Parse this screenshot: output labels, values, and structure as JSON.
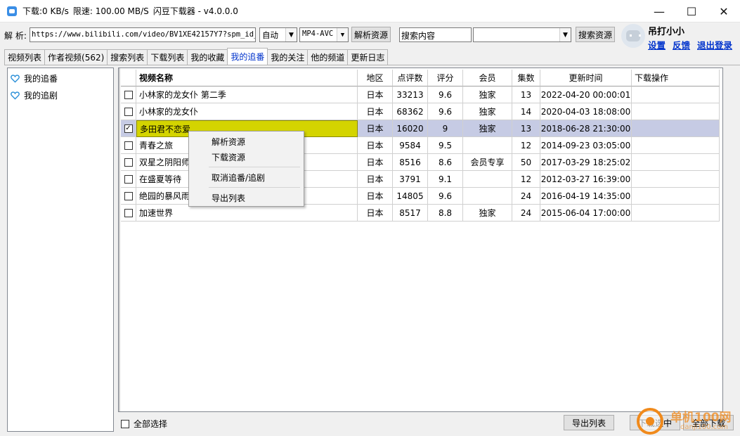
{
  "titlebar": {
    "download_speed": "下载:0 KB/s",
    "limit_speed": "限速: 100.00 MB/S",
    "app_name": "闪豆下载器 - v4.0.0.0",
    "minimize": "—",
    "maximize": "☐",
    "close": "✕"
  },
  "toolbar": {
    "parse_label": "解 析:",
    "url_value": "https://www.bilibili.com/video/BV1XE42157Y7?spm_id_fr",
    "quality_value": "自动",
    "format_value": "MP4-AVC",
    "parse_button": "解析资源",
    "search_placeholder": "搜索内容",
    "search_type_value": "",
    "search_button": "搜索资源"
  },
  "user": {
    "name": "吊打小小",
    "settings": "设置",
    "feedback": "反馈",
    "logout": "退出登录"
  },
  "tabs": [
    {
      "label": "视频列表"
    },
    {
      "label": "作者视频(562)"
    },
    {
      "label": "搜索列表"
    },
    {
      "label": "下载列表"
    },
    {
      "label": "我的收藏"
    },
    {
      "label": "我的追番",
      "active": true
    },
    {
      "label": "我的关注"
    },
    {
      "label": "他的频道"
    },
    {
      "label": "更新日志"
    }
  ],
  "left_panel": {
    "items": [
      {
        "label": "我的追番"
      },
      {
        "label": "我的追剧"
      }
    ]
  },
  "table": {
    "headers": {
      "name": "视频名称",
      "region": "地区",
      "comments": "点评数",
      "rating": "评分",
      "member": "会员",
      "episodes": "集数",
      "updated": "更新时间",
      "action": "下载操作"
    },
    "rows": [
      {
        "checked": false,
        "name": "小林家的龙女仆 第二季",
        "region": "日本",
        "comments": "33213",
        "rating": "9.6",
        "member": "独家",
        "episodes": "13",
        "updated": "2022-04-20 00:00:01",
        "action": ""
      },
      {
        "checked": false,
        "name": "小林家的龙女仆",
        "region": "日本",
        "comments": "68362",
        "rating": "9.6",
        "member": "独家",
        "episodes": "14",
        "updated": "2020-04-03 18:08:00",
        "action": ""
      },
      {
        "checked": true,
        "name": "多田君不恋爱",
        "region": "日本",
        "comments": "16020",
        "rating": "9",
        "member": "独家",
        "episodes": "13",
        "updated": "2018-06-28 21:30:00",
        "action": ""
      },
      {
        "checked": false,
        "name": "青春之旅",
        "region": "日本",
        "comments": "9584",
        "rating": "9.5",
        "member": "",
        "episodes": "12",
        "updated": "2014-09-23 03:05:00",
        "action": ""
      },
      {
        "checked": false,
        "name": "双星之阴阳师",
        "region": "日本",
        "comments": "8516",
        "rating": "8.6",
        "member": "会员专享",
        "episodes": "50",
        "updated": "2017-03-29 18:25:02",
        "action": ""
      },
      {
        "checked": false,
        "name": "在盛夏等待",
        "region": "日本",
        "comments": "3791",
        "rating": "9.1",
        "member": "",
        "episodes": "12",
        "updated": "2012-03-27 16:39:00",
        "action": ""
      },
      {
        "checked": false,
        "name": "绝园的暴风雨",
        "region": "日本",
        "comments": "14805",
        "rating": "9.6",
        "member": "",
        "episodes": "24",
        "updated": "2016-04-19 14:35:00",
        "action": ""
      },
      {
        "checked": false,
        "name": "加速世界",
        "region": "日本",
        "comments": "8517",
        "rating": "8.8",
        "member": "独家",
        "episodes": "24",
        "updated": "2015-06-04 17:00:00",
        "action": ""
      }
    ],
    "selected_row": 2
  },
  "context_menu": {
    "items": [
      "解析资源",
      "下载资源",
      "取消追番/追剧",
      "导出列表"
    ]
  },
  "bottom": {
    "select_all": "全部选择",
    "export_list": "导出列表",
    "download_selected": "下载选中",
    "download_all": "全部下载"
  },
  "watermark": {
    "text": "单机100网",
    "sub": "danji100.com"
  },
  "colors": {
    "link": "#0033cc",
    "selected_row": "#c6cbe4",
    "selected_name": "#d4d400",
    "watermark": "#f08a1c"
  }
}
